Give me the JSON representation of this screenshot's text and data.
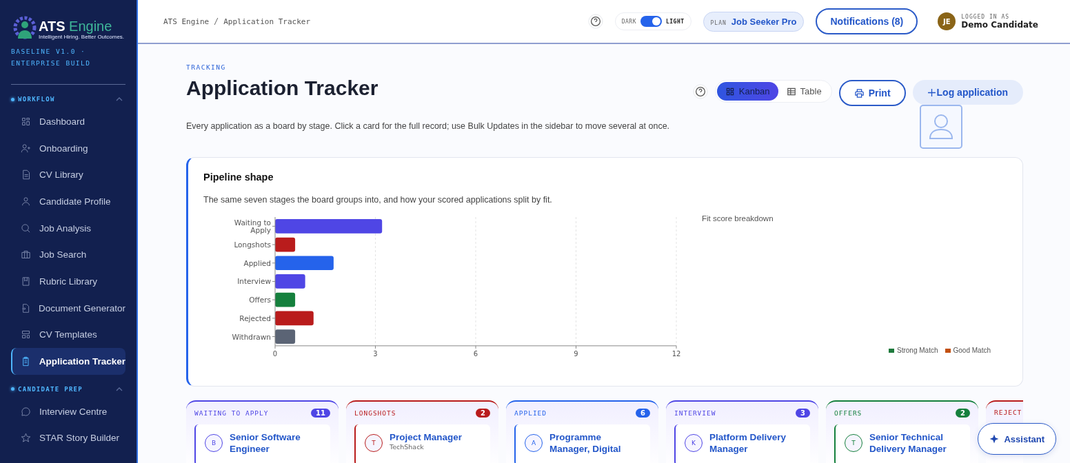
{
  "sidebar": {
    "brand": {
      "name": "ATS",
      "accent": "Engine",
      "tagline": "Intelligent Hiring. Better Outcomes."
    },
    "build": "BASELINE V1.0 · ENTERPRISE BUILD",
    "sections": [
      {
        "title": "WORKFLOW",
        "expanded": true,
        "items": [
          {
            "label": "Dashboard",
            "selected": false
          },
          {
            "label": "Onboarding",
            "selected": false
          },
          {
            "label": "CV Library",
            "selected": false
          },
          {
            "label": "Candidate Profile",
            "selected": false
          },
          {
            "label": "Job Analysis",
            "selected": false
          },
          {
            "label": "Job Search",
            "selected": false
          },
          {
            "label": "Rubric Library",
            "selected": false
          },
          {
            "label": "Document Generator",
            "selected": false
          },
          {
            "label": "CV Templates",
            "selected": false
          },
          {
            "label": "Application Tracker",
            "selected": true
          }
        ]
      },
      {
        "title": "CANDIDATE PREP",
        "expanded": true,
        "items": [
          {
            "label": "Interview Centre",
            "selected": false
          },
          {
            "label": "STAR Story Builder",
            "selected": false
          }
        ]
      }
    ]
  },
  "header": {
    "breadcrumb": [
      "ATS Engine",
      "Application Tracker"
    ],
    "theme": {
      "dark_label": "DARK",
      "light_label": "LIGHT",
      "on": true
    },
    "plan": {
      "label": "PLAN",
      "value": "Job Seeker Pro"
    },
    "notifications": "Notifications (8)",
    "user": {
      "initials": "JE",
      "caption": "LOGGED IN AS",
      "name": "Demo Candidate"
    }
  },
  "page": {
    "eyebrow": "TRACKING",
    "title": "Application Tracker",
    "description": "Every application as a board by stage. Click a card for the full record; use Bulk Updates in the sidebar to move several at once.",
    "views": [
      {
        "label": "Kanban",
        "selected": true
      },
      {
        "label": "Table",
        "selected": false
      }
    ],
    "print": "Print",
    "log": "Log application"
  },
  "pipeline": {
    "title": "Pipeline shape",
    "subtitle": "The same seven stages the board groups into, and how your scored applications split by fit.",
    "chart_data": {
      "type": "bar",
      "orientation": "horizontal",
      "categories": [
        "Waiting to Apply",
        "Longshots",
        "Applied",
        "Interview",
        "Offers",
        "Rejected",
        "Withdrawn"
      ],
      "values": [
        3.2,
        0.6,
        1.75,
        0.9,
        0.6,
        1.15,
        0.6
      ],
      "grid": true,
      "colors": [
        "#4f46e5",
        "#b91c1c",
        "#2563eb",
        "#4f46e5",
        "#15803d",
        "#b91c1c",
        "#5b6475"
      ],
      "xlim": [
        0,
        12
      ],
      "xticks": [
        0,
        3,
        6,
        9,
        12
      ]
    },
    "fit": {
      "title": "Fit score breakdown",
      "legend": [
        {
          "label": "Strong Match",
          "color": "#1e7a3c"
        },
        {
          "label": "Good Match",
          "color": "#c2500f"
        }
      ]
    }
  },
  "columns": [
    {
      "label": "WAITING TO APPLY",
      "count": "11",
      "color": "#4f46e5",
      "cards": [
        {
          "initial": "B",
          "title": "Senior Software Engineer"
        }
      ]
    },
    {
      "label": "LONGSHOTS",
      "count": "2",
      "color": "#b91c1c",
      "cards": [
        {
          "initial": "T",
          "title": "Project Manager",
          "company": "TechShack"
        }
      ]
    },
    {
      "label": "APPLIED",
      "count": "6",
      "color": "#2563eb",
      "cards": [
        {
          "initial": "A",
          "title": "Programme Manager, Digital"
        }
      ]
    },
    {
      "label": "INTERVIEW",
      "count": "3",
      "color": "#4f46e5",
      "cards": [
        {
          "initial": "K",
          "title": "Platform Delivery Manager"
        }
      ]
    },
    {
      "label": "OFFERS",
      "count": "2",
      "color": "#15803d",
      "cards": [
        {
          "initial": "T",
          "title": "Senior Technical Delivery Manager"
        }
      ]
    },
    {
      "label": "REJECT",
      "color": "#b91c1c"
    }
  ],
  "assistant": "Assistant"
}
